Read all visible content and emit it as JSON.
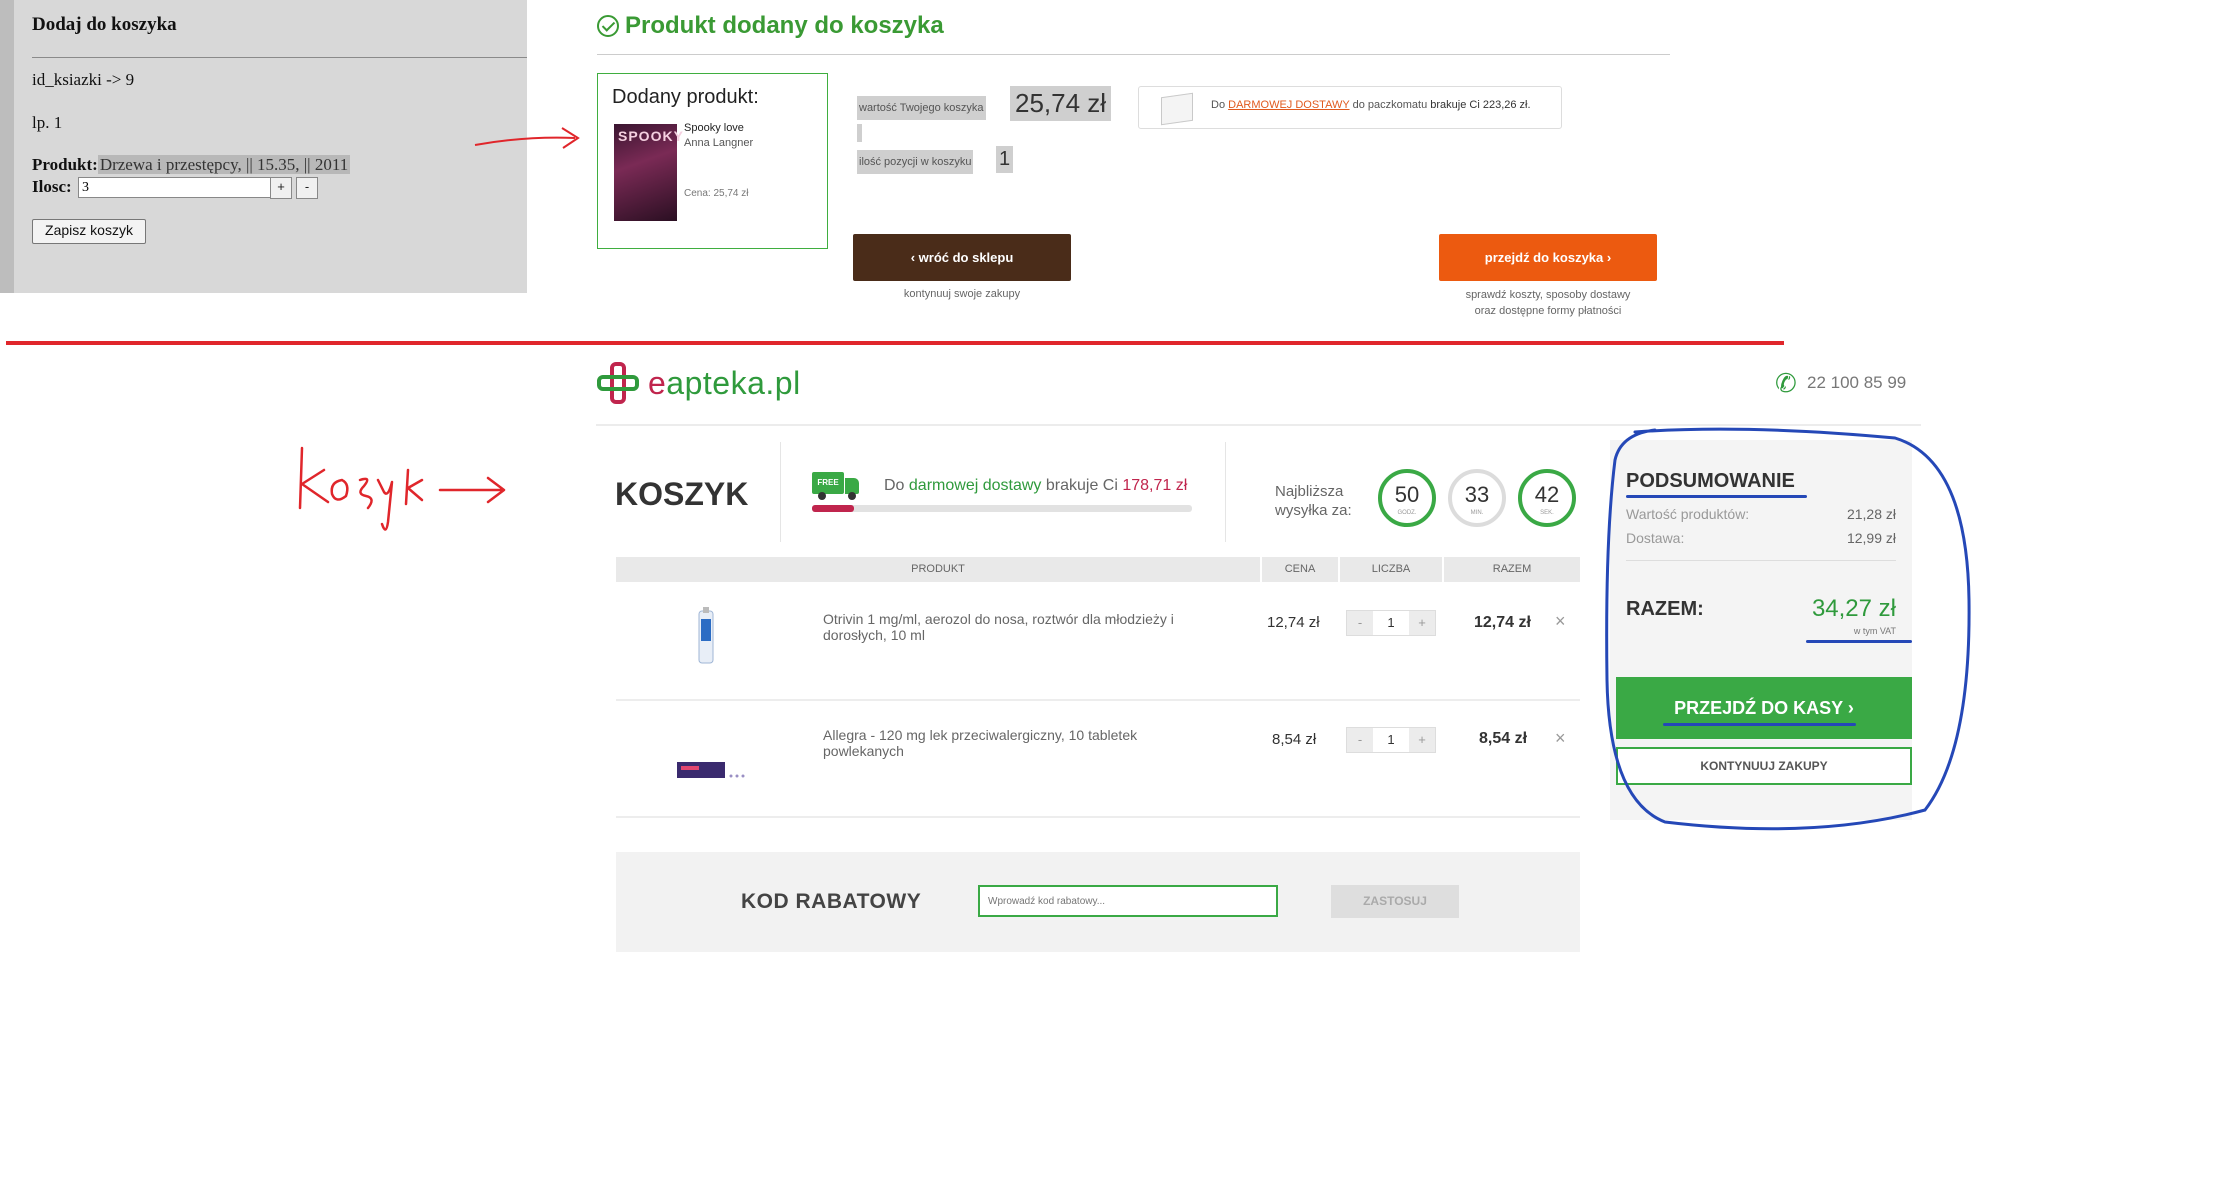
{
  "admin": {
    "title": "Dodaj do koszyka",
    "id_line": "id_ksiazki -> 9",
    "lp_line": "lp. 1",
    "product_label": "Produkt:",
    "product_value": "Drzewa i przestępcy, || 15.35, || 2011",
    "qty_label": "Ilosc:",
    "qty_value": "3",
    "plus": "+",
    "minus": "-",
    "save_label": "Zapisz koszyk"
  },
  "popup": {
    "title": "Produkt dodany do koszyka",
    "added_heading": "Dodany produkt:",
    "cover_text": "SPOOKY",
    "product_title": "Spooky love",
    "product_author": "Anna Langner",
    "product_price": "Cena: 25,74 zł",
    "cart_value_label": "wartość Twojego koszyka",
    "cart_value": "25,74 zł",
    "items_label": "ilość pozycji w koszyku",
    "items_value": "1",
    "free_prefix": "Do",
    "free_link": "DARMOWEJ DOSTAWY",
    "free_middle": "do paczkomatu",
    "free_suffix": "brakuje Ci 223,26 zł.",
    "back_label": "‹  wróć do sklepu",
    "back_sub": "kontynuuj swoje zakupy",
    "cart_label": "przejdź do koszyka  ›",
    "cart_sub_1": "sprawdź koszty, sposoby dostawy",
    "cart_sub_2": "oraz dostępne formy płatności"
  },
  "annotations": {
    "koszyk_note": "koszyk",
    "colors": {
      "red": "#e0262b",
      "blue": "#2548b7"
    }
  },
  "store": {
    "logo_e": "e",
    "logo_rest": "apteka.pl",
    "phone": "22 100 85 99",
    "cart_title": "KOSZYK",
    "truck_label": "FREE",
    "ship_prefix": "Do",
    "ship_link": "darmowej dostawy",
    "ship_middle": "brakuje Ci",
    "ship_amount": "178,71 zł",
    "ship_progress": 0.11,
    "nearest_1": "Najbliższa",
    "nearest_2": "wysyłka za:",
    "timers": [
      {
        "value": "50",
        "unit": "GODZ."
      },
      {
        "value": "33",
        "unit": "MIN."
      },
      {
        "value": "42",
        "unit": "SEK."
      }
    ],
    "columns": {
      "product": "PRODUKT",
      "price": "CENA",
      "qty": "LICZBA",
      "total": "RAZEM"
    },
    "items": [
      {
        "name": "Otrivin 1 mg/ml, aerozol do nosa, roztwór dla młodzieży i dorosłych, 10 ml",
        "price": "12,74 zł",
        "qty": "1",
        "total": "12,74 zł",
        "minus": "-",
        "plus": "+",
        "remove": "×"
      },
      {
        "name": "Allegra - 120 mg lek przeciwalergiczny, 10 tabletek powlekanych",
        "price": "8,54 zł",
        "qty": "1",
        "total": "8,54 zł",
        "minus": "-",
        "plus": "+",
        "remove": "×"
      }
    ],
    "coupon_label": "KOD RABATOWY",
    "coupon_placeholder": "Wprowadź kod rabatowy...",
    "coupon_apply": "ZASTOSUJ",
    "summary": {
      "title": "PODSUMOWANIE",
      "products_label": "Wartość produktów:",
      "products_value": "21,28 zł",
      "delivery_label": "Dostawa:",
      "delivery_value": "12,99 zł",
      "total_label": "RAZEM:",
      "total_value": "34,27 zł",
      "vat_note": "w tym VAT",
      "checkout_label": "PRZEJDŹ DO KASY  ›",
      "continue_label": "KONTYNUUJ ZAKUPY"
    }
  }
}
